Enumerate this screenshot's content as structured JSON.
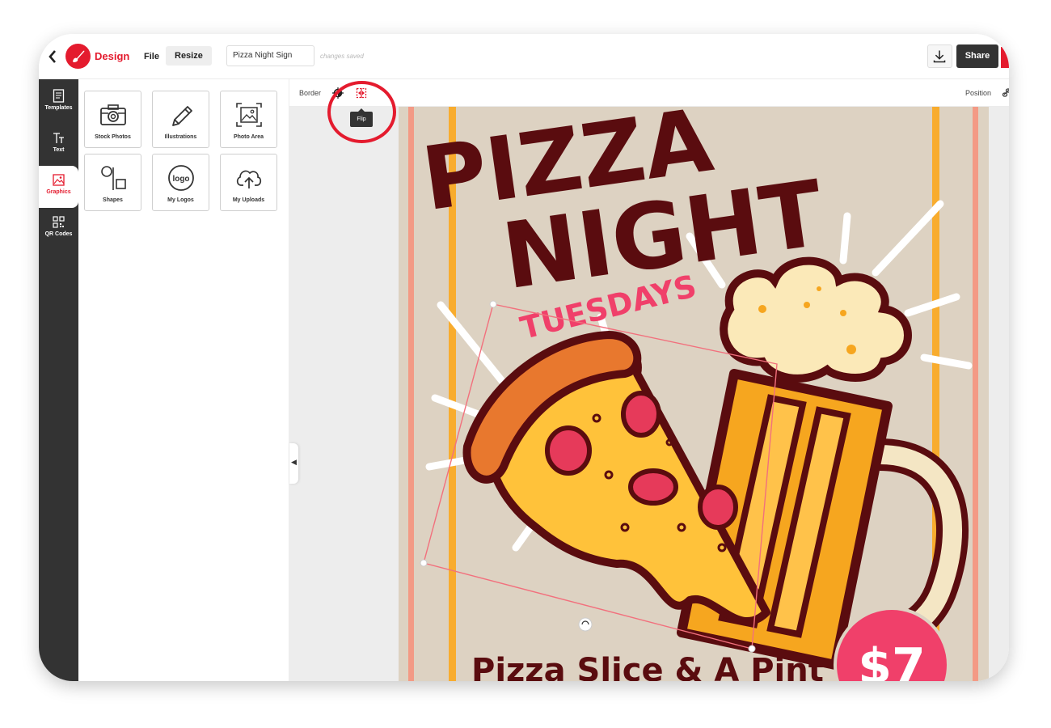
{
  "header": {
    "back_icon": "chevron-left-icon",
    "brand": "Design",
    "menu": {
      "file": "File",
      "resize": "Resize"
    },
    "document_name": "Pizza Night Sign",
    "save_status": "changes saved",
    "share_label": "Share"
  },
  "sidebar": {
    "items": [
      {
        "label": "Templates",
        "icon": "templates-icon"
      },
      {
        "label": "Text",
        "icon": "text-icon"
      },
      {
        "label": "Graphics",
        "icon": "graphics-icon",
        "active": true
      },
      {
        "label": "QR Codes",
        "icon": "qr-code-icon"
      }
    ]
  },
  "graphics_panel": {
    "tiles": [
      {
        "label": "Stock Photos",
        "icon": "camera-icon"
      },
      {
        "label": "Illustrations",
        "icon": "pencil-icon"
      },
      {
        "label": "Photo Area",
        "icon": "photo-area-icon"
      },
      {
        "label": "Shapes",
        "icon": "shapes-icon"
      },
      {
        "label": "My Logos",
        "icon": "logo-icon"
      },
      {
        "label": "My Uploads",
        "icon": "upload-icon"
      }
    ]
  },
  "toolbar": {
    "border_label": "Border",
    "flip_tooltip": "Flip",
    "position_label": "Position"
  },
  "poster": {
    "title_line1": "PIZZA",
    "title_line2": "NIGHT",
    "subtitle": "TUESDAYS",
    "bottom_text": "Pizza Slice & A Pint",
    "price": "$7"
  },
  "colors": {
    "accent": "#e41b2e",
    "rail": "#333333",
    "poster_bg": "#ddd2c2",
    "poster_title": "#5a0c0f",
    "poster_subtitle": "#f0406a"
  }
}
